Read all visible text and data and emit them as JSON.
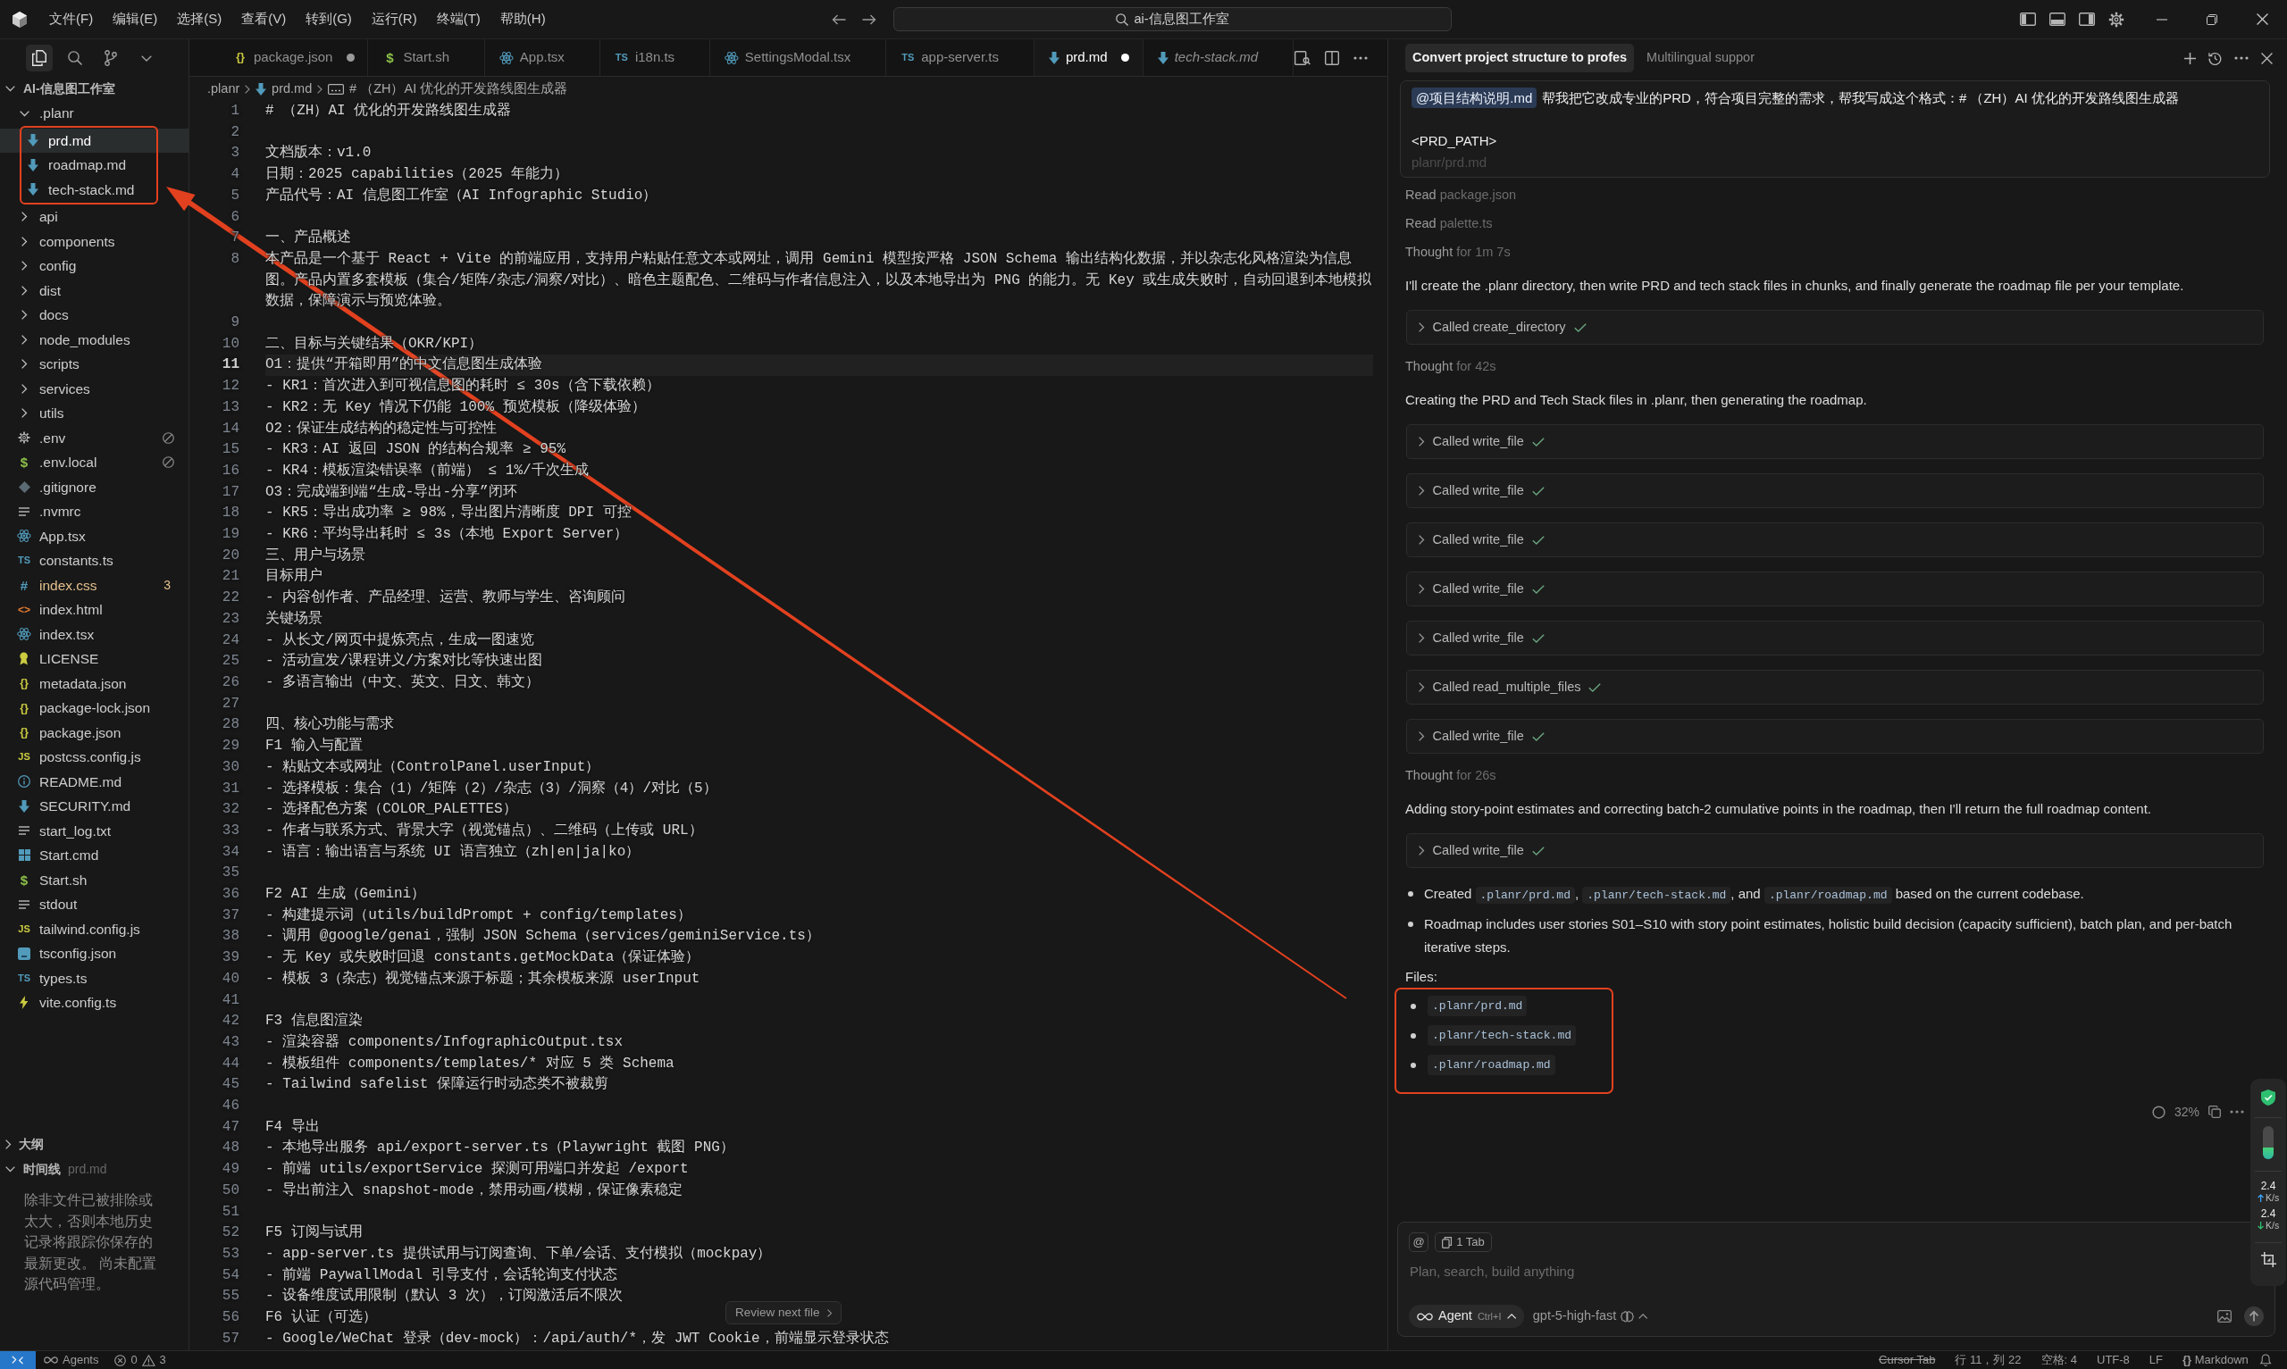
{
  "title_bar": {
    "menu": [
      "文件(F)",
      "编辑(E)",
      "选择(S)",
      "查看(V)",
      "转到(G)",
      "运行(R)",
      "终端(T)",
      "帮助(H)"
    ],
    "command_center": "ai-信息图工作室"
  },
  "explorer": {
    "views": [
      {
        "kind": "files",
        "selected": true
      },
      {
        "kind": "search",
        "selected": false
      },
      {
        "kind": "source_control",
        "selected": false
      }
    ],
    "root": {
      "label": "AI-信息图工作室",
      "expanded": true
    },
    "items": [
      {
        "name": ".planr",
        "kind": "folder",
        "expanded": true,
        "highlighted": true,
        "selected": false,
        "children": [
          {
            "name": "prd.md",
            "kind": "markdown",
            "selected": true,
            "ignored": false
          },
          {
            "name": "roadmap.md",
            "kind": "markdown",
            "selected": false,
            "ignored": false
          },
          {
            "name": "tech-stack.md",
            "kind": "markdown",
            "selected": false,
            "ignored": false
          }
        ]
      },
      {
        "name": "api",
        "kind": "folder",
        "expanded": false,
        "highlighted": false,
        "selected": false
      },
      {
        "name": "components",
        "kind": "folder",
        "expanded": false,
        "highlighted": false,
        "selected": false
      },
      {
        "name": "config",
        "kind": "folder",
        "expanded": false,
        "highlighted": false,
        "selected": false
      },
      {
        "name": "dist",
        "kind": "folder",
        "expanded": false,
        "highlighted": false,
        "selected": false
      },
      {
        "name": "docs",
        "kind": "folder",
        "expanded": false,
        "highlighted": false,
        "selected": false
      },
      {
        "name": "node_modules",
        "kind": "folder",
        "expanded": false,
        "highlighted": false,
        "selected": false
      },
      {
        "name": "scripts",
        "kind": "folder",
        "expanded": false,
        "highlighted": false,
        "selected": false
      },
      {
        "name": "services",
        "kind": "folder",
        "expanded": false,
        "highlighted": false,
        "selected": false
      },
      {
        "name": "utils",
        "kind": "folder",
        "expanded": false,
        "highlighted": false,
        "selected": false
      },
      {
        "name": ".env",
        "kind": "settings",
        "selected": false,
        "ignored": true
      },
      {
        "name": ".env.local",
        "kind": "shell",
        "glyph": "$",
        "selected": false,
        "ignored": true
      },
      {
        "name": ".gitignore",
        "kind": "git",
        "selected": false,
        "ignored": false
      },
      {
        "name": ".nvmrc",
        "kind": "text",
        "selected": false,
        "ignored": false
      },
      {
        "name": "App.tsx",
        "kind": "react",
        "selected": false,
        "ignored": false
      },
      {
        "name": "constants.ts",
        "kind": "typescript",
        "glyph": "TS",
        "selected": false,
        "ignored": false
      },
      {
        "name": "index.css",
        "kind": "css",
        "glyph": "#",
        "problems": "3",
        "selected": false,
        "ignored": false
      },
      {
        "name": "index.html",
        "kind": "html",
        "glyph": "<>",
        "selected": false,
        "ignored": false
      },
      {
        "name": "index.tsx",
        "kind": "react",
        "selected": false,
        "ignored": false
      },
      {
        "name": "LICENSE",
        "kind": "license",
        "selected": false,
        "ignored": false
      },
      {
        "name": "metadata.json",
        "kind": "json",
        "glyph": "{}",
        "selected": false,
        "ignored": false
      },
      {
        "name": "package-lock.json",
        "kind": "json",
        "glyph": "{}",
        "selected": false,
        "ignored": false
      },
      {
        "name": "package.json",
        "kind": "json",
        "glyph": "{}",
        "selected": false,
        "ignored": false
      },
      {
        "name": "postcss.config.js",
        "kind": "javascript",
        "glyph": "JS",
        "selected": false,
        "ignored": false
      },
      {
        "name": "README.md",
        "kind": "info",
        "selected": false,
        "ignored": false
      },
      {
        "name": "SECURITY.md",
        "kind": "markdown",
        "selected": false,
        "ignored": false
      },
      {
        "name": "start_log.txt",
        "kind": "text",
        "selected": false,
        "ignored": false
      },
      {
        "name": "Start.cmd",
        "kind": "windows",
        "selected": false,
        "ignored": false
      },
      {
        "name": "Start.sh",
        "kind": "shell",
        "glyph": "$",
        "selected": false,
        "ignored": false
      },
      {
        "name": "stdout",
        "kind": "text",
        "selected": false,
        "ignored": false
      },
      {
        "name": "tailwind.config.js",
        "kind": "javascript",
        "glyph": "JS",
        "selected": false,
        "ignored": false
      },
      {
        "name": "tsconfig.json",
        "kind": "tsconfig",
        "selected": false,
        "ignored": false
      },
      {
        "name": "types.ts",
        "kind": "typescript",
        "glyph": "TS",
        "selected": false,
        "ignored": false
      },
      {
        "name": "vite.config.ts",
        "kind": "vite",
        "selected": false,
        "ignored": false
      }
    ]
  },
  "outline": {
    "title": "大纲",
    "expanded": false
  },
  "timeline": {
    "title": "时间线",
    "file": "prd.md",
    "expanded": true,
    "message": "除非文件已被排除或太大，否则本地历史记录将跟踪你保存的最新更改。 尚未配置源代码管理。"
  },
  "editor": {
    "tabs": [
      {
        "label": "package.json",
        "kind": "json",
        "glyph": "{}",
        "modified": true,
        "selected": false,
        "preview": false
      },
      {
        "label": "Start.sh",
        "kind": "shell",
        "glyph": "$",
        "modified": false,
        "selected": false,
        "preview": false
      },
      {
        "label": "App.tsx",
        "kind": "react",
        "modified": false,
        "selected": false,
        "preview": false
      },
      {
        "label": "i18n.ts",
        "kind": "typescript",
        "glyph": "TS",
        "modified": false,
        "selected": false,
        "preview": false
      },
      {
        "label": "SettingsModal.tsx",
        "kind": "react",
        "modified": false,
        "selected": false,
        "preview": false
      },
      {
        "label": "app-server.ts",
        "kind": "typescript",
        "glyph": "TS",
        "modified": false,
        "selected": false,
        "preview": false
      },
      {
        "label": "prd.md",
        "kind": "markdown",
        "modified": true,
        "selected": true,
        "preview": false
      },
      {
        "label": "tech-stack.md",
        "kind": "markdown",
        "modified": false,
        "selected": false,
        "preview": true
      }
    ],
    "breadcrumb": [
      {
        "text": ".planr",
        "kind": "folder"
      },
      {
        "text": "prd.md",
        "kind": "markdown"
      },
      {
        "text": "# （ZH）AI 优化的开发路线图生成器",
        "kind": "symbol"
      }
    ],
    "lines": [
      {
        "number": "1",
        "text": "# （ZH）AI 优化的开发路线图生成器",
        "current": false
      },
      {
        "number": "2",
        "current": false
      },
      {
        "number": "3",
        "text": "文档版本：v1.0",
        "current": false
      },
      {
        "number": "4",
        "text": "日期：2025 capabilities（2025 年能力）",
        "current": false
      },
      {
        "number": "5",
        "text": "产品代号：AI 信息图工作室（AI Infographic Studio）",
        "current": false
      },
      {
        "number": "6",
        "current": false
      },
      {
        "number": "7",
        "text": "一、产品概述",
        "current": false
      },
      {
        "number": "8",
        "text": "本产品是一个基于 React + Vite 的前端应用，支持用户粘贴任意文本或网址，调用 Gemini 模型按严格 JSON Schema 输出结构化数据，并以杂志化风格渲染为信息图。产品内置多套模板（集合/矩阵/杂志/洞察/对比）、暗色主题配色、二维码与作者信息注入，以及本地导出为 PNG 的能力。无 Key 或生成失败时，自动回退到本地模拟数据，保障演示与预览体验。",
        "current": false
      },
      {
        "number": "9",
        "current": false
      },
      {
        "number": "10",
        "text": "二、目标与关键结果（OKR/KPI）",
        "current": false
      },
      {
        "number": "11",
        "text": "O1：提供“开箱即用”的中文信息图生成体验",
        "current": true
      },
      {
        "number": "12",
        "text": "- KR1：首次进入到可视信息图的耗时 ≤ 30s（含下载依赖）",
        "current": false
      },
      {
        "number": "13",
        "text": "- KR2：无 Key 情况下仍能 100% 预览模板（降级体验）",
        "current": false
      },
      {
        "number": "14",
        "text": "O2：保证生成结构的稳定性与可控性",
        "current": false
      },
      {
        "number": "15",
        "text": "- KR3：AI 返回 JSON 的结构合规率 ≥ 95%",
        "current": false
      },
      {
        "number": "16",
        "text": "- KR4：模板渲染错误率（前端） ≤ 1%/千次生成",
        "current": false
      },
      {
        "number": "17",
        "text": "O3：完成端到端“生成-导出-分享”闭环",
        "current": false
      },
      {
        "number": "18",
        "text": "- KR5：导出成功率 ≥ 98%，导出图片清晰度 DPI 可控",
        "current": false
      },
      {
        "number": "19",
        "text": "- KR6：平均导出耗时 ≤ 3s（本地 Export Server）",
        "current": false
      },
      {
        "number": "20",
        "text": "三、用户与场景",
        "current": false
      },
      {
        "number": "21",
        "text": "目标用户",
        "current": false
      },
      {
        "number": "22",
        "text": "- 内容创作者、产品经理、运营、教师与学生、咨询顾问",
        "current": false
      },
      {
        "number": "23",
        "text": "关键场景",
        "current": false
      },
      {
        "number": "24",
        "text": "- 从长文/网页中提炼亮点，生成一图速览",
        "current": false
      },
      {
        "number": "25",
        "text": "- 活动宣发/课程讲义/方案对比等快速出图",
        "current": false
      },
      {
        "number": "26",
        "text": "- 多语言输出（中文、英文、日文、韩文）",
        "current": false
      },
      {
        "number": "27",
        "current": false
      },
      {
        "number": "28",
        "text": "四、核心功能与需求",
        "current": false
      },
      {
        "number": "29",
        "text": "F1 输入与配置",
        "current": false
      },
      {
        "number": "30",
        "text": "- 粘贴文本或网址（ControlPanel.userInput）",
        "current": false
      },
      {
        "number": "31",
        "text": "- 选择模板：集合（1）/矩阵（2）/杂志（3）/洞察（4）/对比（5）",
        "current": false
      },
      {
        "number": "32",
        "text": "- 选择配色方案（COLOR_PALETTES）",
        "current": false
      },
      {
        "number": "33",
        "text": "- 作者与联系方式、背景大字（视觉锚点）、二维码（上传或 URL）",
        "current": false
      },
      {
        "number": "34",
        "text": "- 语言：输出语言与系统 UI 语言独立（zh|en|ja|ko）",
        "current": false
      },
      {
        "number": "35",
        "current": false
      },
      {
        "number": "36",
        "text": "F2 AI 生成（Gemini）",
        "current": false
      },
      {
        "number": "37",
        "text": "- 构建提示词（utils/buildPrompt + config/templates）",
        "current": false
      },
      {
        "number": "38",
        "text": "- 调用 @google/genai，强制 JSON Schema（services/geminiService.ts）",
        "current": false
      },
      {
        "number": "39",
        "text": "- 无 Key 或失败时回退 constants.getMockData（保证体验）",
        "current": false
      },
      {
        "number": "40",
        "text": "- 模板 3（杂志）视觉锚点来源于标题；其余模板来源 userInput",
        "current": false
      },
      {
        "number": "41",
        "current": false
      },
      {
        "number": "42",
        "text": "F3 信息图渲染",
        "current": false
      },
      {
        "number": "43",
        "text": "- 渲染容器 components/InfographicOutput.tsx",
        "current": false
      },
      {
        "number": "44",
        "text": "- 模板组件 components/templates/* 对应 5 类 Schema",
        "current": false
      },
      {
        "number": "45",
        "text": "- Tailwind safelist 保障运行时动态类不被裁剪",
        "current": false
      },
      {
        "number": "46",
        "current": false
      },
      {
        "number": "47",
        "text": "F4 导出",
        "current": false
      },
      {
        "number": "48",
        "text": "- 本地导出服务 api/export-server.ts（Playwright 截图 PNG）",
        "current": false
      },
      {
        "number": "49",
        "text": "- 前端 utils/exportService 探测可用端口并发起 /export",
        "current": false
      },
      {
        "number": "50",
        "text": "- 导出前注入 snapshot-mode，禁用动画/模糊，保证像素稳定",
        "current": false
      },
      {
        "number": "51",
        "current": false
      },
      {
        "number": "52",
        "text": "F5 订阅与试用",
        "current": false
      },
      {
        "number": "53",
        "text": "- app-server.ts 提供试用与订阅查询、下单/会话、支付模拟（mockpay）",
        "current": false
      },
      {
        "number": "54",
        "text": "- 前端 PaywallModal 引导支付，会话轮询支付状态",
        "current": false
      },
      {
        "number": "55",
        "text": "- 设备维度试用限制（默认 3 次），订阅激活后不限次",
        "current": false
      },
      {
        "number": "56",
        "text": "F6 认证（可选）",
        "current": false
      },
      {
        "number": "57",
        "text": "- Google/WeChat 登录（dev-mock）：/api/auth/*，发 JWT Cookie，前端显示登录状态",
        "current": false
      }
    ],
    "review_button": "Review next file"
  },
  "chat": {
    "tabs": [
      {
        "label": "Convert project structure to profes",
        "selected": true
      },
      {
        "label": "Multilingual suppor",
        "selected": false
      }
    ],
    "prompt": {
      "mention": "@项目结构说明.md",
      "text": "帮我把它改成专业的PRD，符合项目完整的需求，帮我写成这个格式：# （ZH）AI 优化的开发路线图生成器",
      "lines": [
        {
          "text": "<PRD_PATH>",
          "faded": false
        },
        {
          "text": "planr/prd.md",
          "faded": true
        }
      ]
    },
    "steps": [
      {
        "kind": "read",
        "verb": "Read",
        "target": "package.json"
      },
      {
        "kind": "read",
        "verb": "Read",
        "target": "palette.ts"
      },
      {
        "kind": "thought",
        "verb": "Thought",
        "target": "for 1m 7s"
      },
      {
        "kind": "text",
        "text": "I'll create the .planr directory, then write PRD and tech stack files in chunks, and finally generate the roadmap file per your template."
      },
      {
        "kind": "tool",
        "label": "Called create_directory",
        "done": true
      },
      {
        "kind": "thought",
        "verb": "Thought",
        "target": "for 42s"
      },
      {
        "kind": "text",
        "text": "Creating the PRD and Tech Stack files in .planr, then generating the roadmap."
      },
      {
        "kind": "tool",
        "label": "Called write_file",
        "done": true
      },
      {
        "kind": "tool",
        "label": "Called write_file",
        "done": true
      },
      {
        "kind": "tool",
        "label": "Called write_file",
        "done": true
      },
      {
        "kind": "tool",
        "label": "Called write_file",
        "done": true
      },
      {
        "kind": "tool",
        "label": "Called write_file",
        "done": true
      },
      {
        "kind": "tool",
        "label": "Called read_multiple_files",
        "done": true
      },
      {
        "kind": "tool",
        "label": "Called write_file",
        "done": true
      },
      {
        "kind": "thought",
        "verb": "Thought",
        "target": "for 26s"
      },
      {
        "kind": "text",
        "text": "Adding story-point estimates and correcting batch-2 cumulative points in the roadmap, then I'll return the full roadmap content."
      },
      {
        "kind": "tool",
        "label": "Called write_file",
        "done": true
      }
    ],
    "summary": [
      {
        "parts": [
          {
            "kind": "text",
            "text": "Created "
          },
          {
            "kind": "code",
            "text": ".planr/prd.md"
          },
          {
            "kind": "text",
            "text": ", "
          },
          {
            "kind": "code",
            "text": ".planr/tech-stack.md"
          },
          {
            "kind": "text",
            "text": ", and "
          },
          {
            "kind": "code",
            "text": ".planr/roadmap.md"
          },
          {
            "kind": "text",
            "text": " based on the current codebase."
          }
        ]
      },
      {
        "parts": [
          {
            "kind": "text",
            "text": "Roadmap includes user stories S01–S10 with story point estimates, holistic build decision (capacity sufficient), batch plan, and per-batch iterative steps."
          }
        ]
      }
    ],
    "files": {
      "label": "Files:",
      "highlighted": true,
      "items": [
        ".planr/prd.md",
        ".planr/tech-stack.md",
        ".planr/roadmap.md"
      ]
    },
    "usage": {
      "text": "32%"
    },
    "input": {
      "mention_button": "@",
      "context_chip": "1 Tab",
      "placeholder": "Plan, search, build anything",
      "mode": "Agent",
      "mode_shortcut": "Ctrl+I",
      "model": "gpt-5-high-fast"
    }
  },
  "net_monitor": {
    "level": 0.35,
    "upload": "2.4",
    "upload_unit": "K/s",
    "download": "2.4",
    "download_unit": "K/s"
  },
  "status_bar": {
    "agents": "Agents",
    "errors": "0",
    "warnings": "3",
    "items": [
      {
        "text": "Cursor Tab",
        "disabled": true
      },
      {
        "text": "行 11，列 22",
        "disabled": false
      },
      {
        "text": "空格: 4",
        "disabled": false
      },
      {
        "text": "UTF-8",
        "disabled": false
      },
      {
        "text": "LF",
        "disabled": false
      },
      {
        "text": "Markdown",
        "glyph": "{}",
        "disabled": false
      }
    ]
  },
  "annotation_arrow": true
}
